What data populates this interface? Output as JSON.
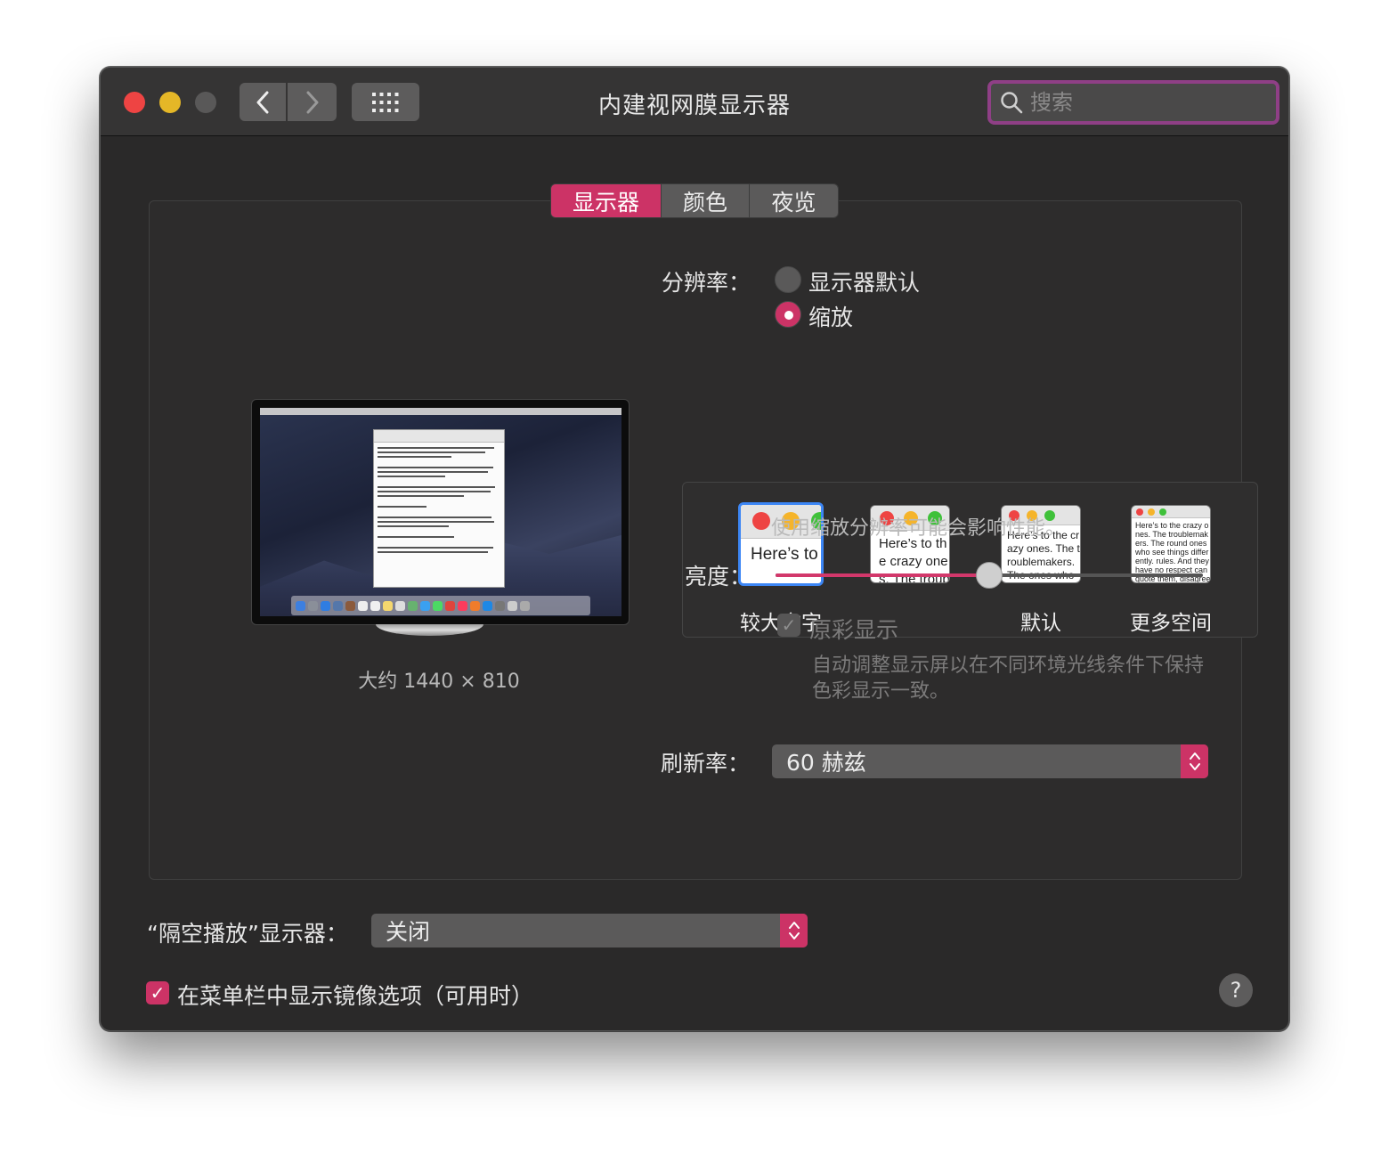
{
  "window": {
    "title": "内建视网膜显示器"
  },
  "search": {
    "placeholder": "搜索"
  },
  "tabs": [
    {
      "label": "显示器",
      "active": true
    },
    {
      "label": "颜色",
      "active": false
    },
    {
      "label": "夜览",
      "active": false
    }
  ],
  "preview": {
    "caption": "大约 1440 × 810"
  },
  "resolution": {
    "label": "分辨率：",
    "options": [
      {
        "label": "显示器默认",
        "selected": false
      },
      {
        "label": "缩放",
        "selected": true
      }
    ],
    "scaled_options": [
      {
        "label": "较大文字",
        "sample": "Here’s to the crazy ones. The troublemakers.",
        "selected": true
      },
      {
        "label": "",
        "sample": "Here’s to the crazy ones. The troublemakers. The ones who",
        "selected": false
      },
      {
        "label": "默认",
        "sample": "Here’s to the crazy ones. The troublemakers. The ones who see things rules. And they",
        "selected": false
      },
      {
        "label": "更多空间",
        "sample": "Here’s to the crazy ones. The troublemakers. The round ones who see things differently. rules. And they have no respect can quote them, disagree them. About the only thing Because they change things",
        "selected": false
      }
    ],
    "note": "使用缩放分辨率可能会影响性能。"
  },
  "brightness": {
    "label": "亮度：",
    "value": 0.5
  },
  "true_tone": {
    "label": "原彩显示",
    "checked": true,
    "enabled": false,
    "description_line1": "自动调整显示屏以在不同环境光线条件下保持",
    "description_line2": "色彩显示一致。"
  },
  "refresh_rate": {
    "label": "刷新率：",
    "value": "60 赫兹"
  },
  "airplay": {
    "label": "“隔空播放”显示器：",
    "value": "关闭"
  },
  "mirroring": {
    "label": "在菜单栏中显示镜像选项（可用时）",
    "checked": true
  },
  "help": {
    "label": "?"
  },
  "colors": {
    "accent": "#cc3366",
    "selection_blue": "#3c86f5"
  }
}
